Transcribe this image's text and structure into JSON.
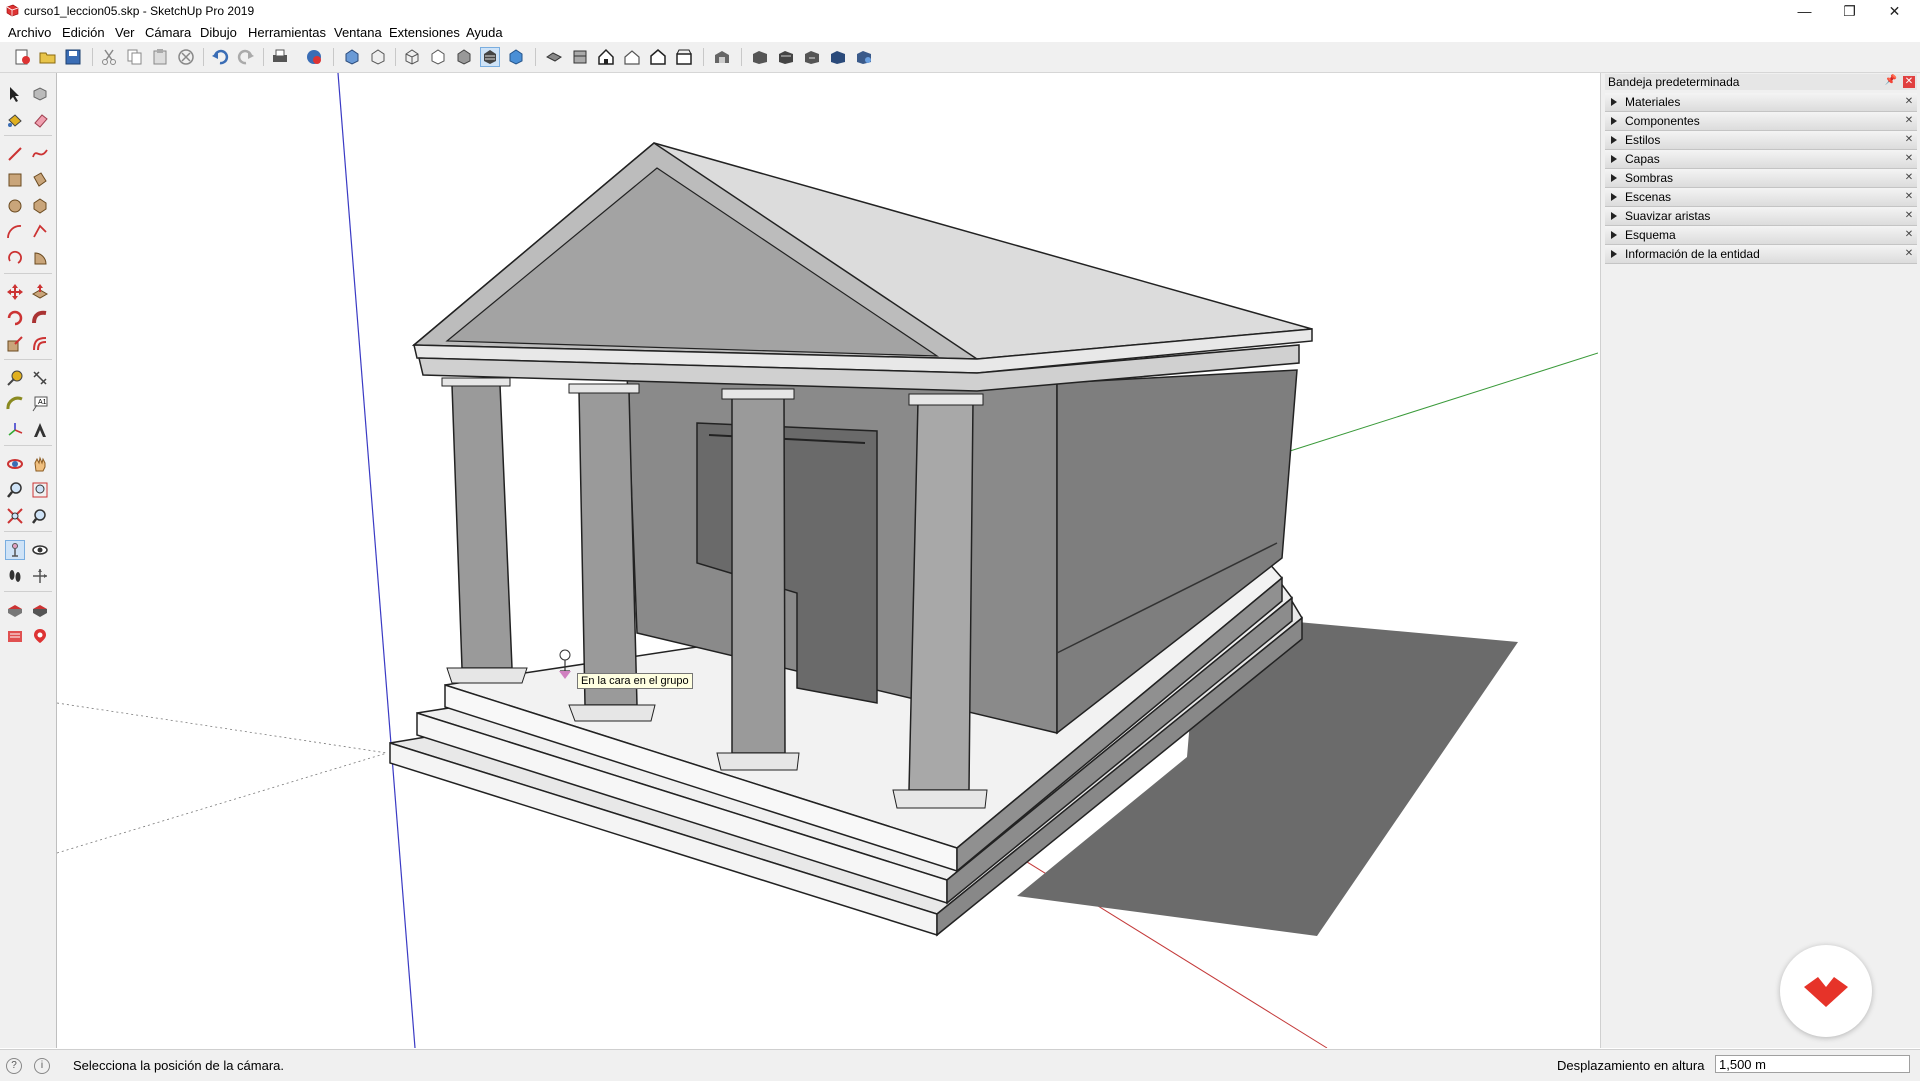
{
  "window": {
    "title": "curso1_leccion05.skp - SketchUp Pro 2019",
    "minimize_glyph": "—",
    "maximize_glyph": "❐",
    "close_glyph": "✕"
  },
  "menu": {
    "items": [
      "Archivo",
      "Edición",
      "Ver",
      "Cámara",
      "Dibujo",
      "Herramientas",
      "Ventana",
      "Extensiones",
      "Ayuda"
    ]
  },
  "toolbar": {
    "icons": [
      "new-model-icon",
      "open-icon",
      "save-icon",
      "cut-icon",
      "copy-icon",
      "paste-icon",
      "erase-selection-icon",
      "undo-icon",
      "redo-icon",
      "print-icon",
      "model-info-icon",
      "select-icon-group",
      "xray-icon",
      "back-edges-icon",
      "wireframe-icon",
      "hidden-line-icon",
      "shaded-icon",
      "shaded-textures-icon",
      "monochrome-icon",
      "iso-view-icon",
      "top-view-icon",
      "front-view-icon",
      "right-view-icon",
      "back-view-icon",
      "left-view-icon",
      "warehouse-icon",
      "extension-warehouse-icon",
      "layout-icon",
      "share-model-icon",
      "share-component-icon",
      "component-options-icon"
    ]
  },
  "left_toolbar": {
    "icons": [
      "select-arrow-icon",
      "component-icon",
      "paint-bucket-icon",
      "eraser-icon",
      "line-icon",
      "freehand-icon",
      "rectangle-icon",
      "rotated-rectangle-icon",
      "circle-icon",
      "polygon-icon",
      "arc-icon",
      "two-point-arc-icon",
      "three-point-arc-icon",
      "pie-icon",
      "move-icon",
      "push-pull-icon",
      "rotate-icon",
      "follow-me-icon",
      "scale-icon",
      "offset-icon",
      "tape-measure-icon",
      "dimension-icon",
      "protractor-icon",
      "text-icon",
      "axes-icon",
      "3d-text-icon",
      "orbit-icon",
      "pan-icon",
      "zoom-icon",
      "zoom-window-icon",
      "zoom-extents-icon",
      "previous-view-icon",
      "position-camera-icon",
      "look-around-icon",
      "walk-icon",
      "section-plane-icon",
      "sandbox-icon",
      "sandbox-scratch-icon",
      "add-location-icon",
      "photo-match-icon"
    ]
  },
  "viewport": {
    "tooltip": "En la cara en el grupo"
  },
  "tray": {
    "title": "Bandeja predeterminada",
    "pin_glyph": "📌",
    "close_glyph": "✕",
    "panels": [
      "Materiales",
      "Componentes",
      "Estilos",
      "Capas",
      "Sombras",
      "Escenas",
      "Suavizar aristas",
      "Esquema",
      "Información de la entidad"
    ],
    "panel_close_glyph": "✕"
  },
  "status": {
    "text": "Selecciona la posición de la cámara.",
    "measure_label": "Desplazamiento en altura",
    "measure_value": "1,500 m"
  },
  "colors": {
    "accent": "#e63329",
    "axis_red": "#c43a3a",
    "axis_green": "#3a9a3a",
    "axis_blue": "#3a3ac4"
  }
}
